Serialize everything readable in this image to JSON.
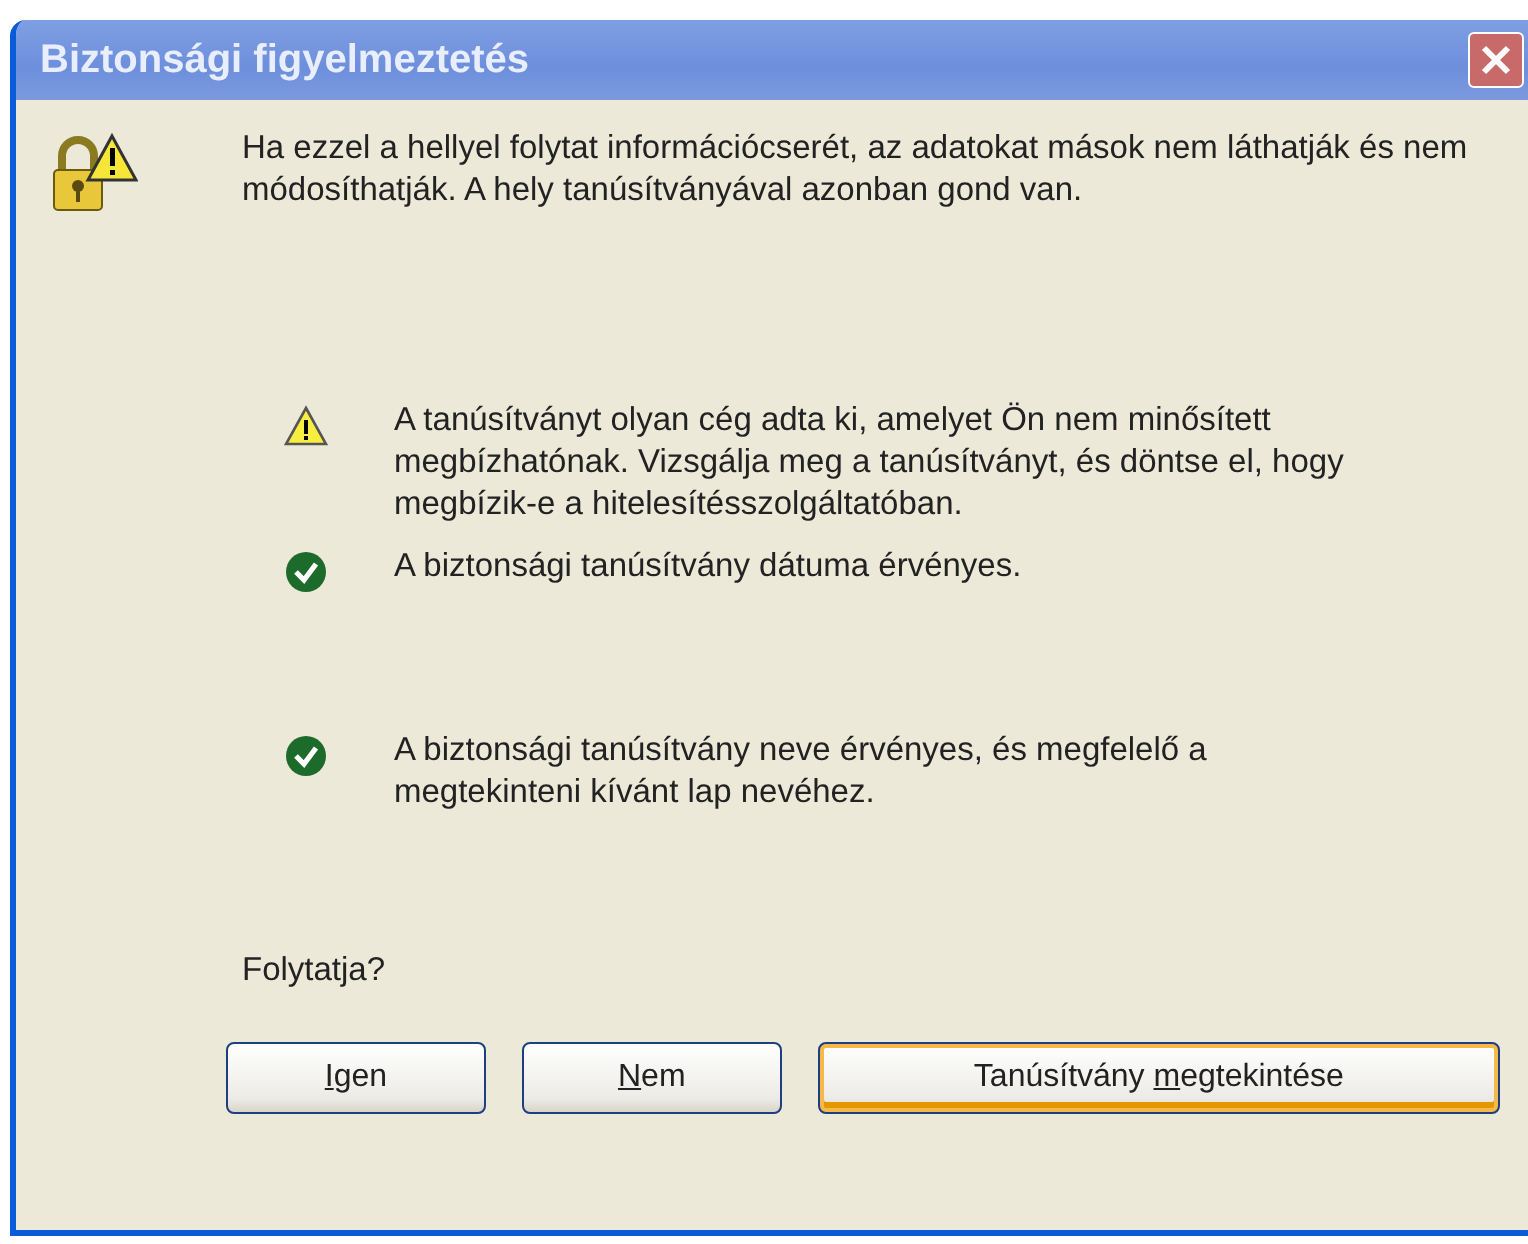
{
  "window": {
    "title": "Biztonsági figyelmeztetés"
  },
  "message": "Ha ezzel a hellyel folytat információcserét, az adatokat mások nem láthatják és nem módosíthatják. A hely tanúsítványával azonban gond van.",
  "checks": [
    {
      "kind": "warning",
      "text": "A tanúsítványt olyan cég adta ki, amelyet Ön nem minősített megbízhatónak. Vizsgálja meg a tanúsítványt, és döntse el, hogy megbízik-e a hitelesítésszolgáltatóban."
    },
    {
      "kind": "ok",
      "text": "A biztonsági tanúsítvány dátuma érvényes."
    },
    {
      "kind": "ok",
      "text": "A biztonsági tanúsítvány neve érvényes, és megfelelő a megtekinteni kívánt lap nevéhez."
    }
  ],
  "question": "Folytatja?",
  "buttons": [
    {
      "key": "I",
      "after": "gen",
      "hovered": false
    },
    {
      "key": "N",
      "after": "em",
      "hovered": false
    },
    {
      "before": "Tanúsítvány ",
      "key": "m",
      "after": "egtekintése",
      "hovered": true
    }
  ]
}
